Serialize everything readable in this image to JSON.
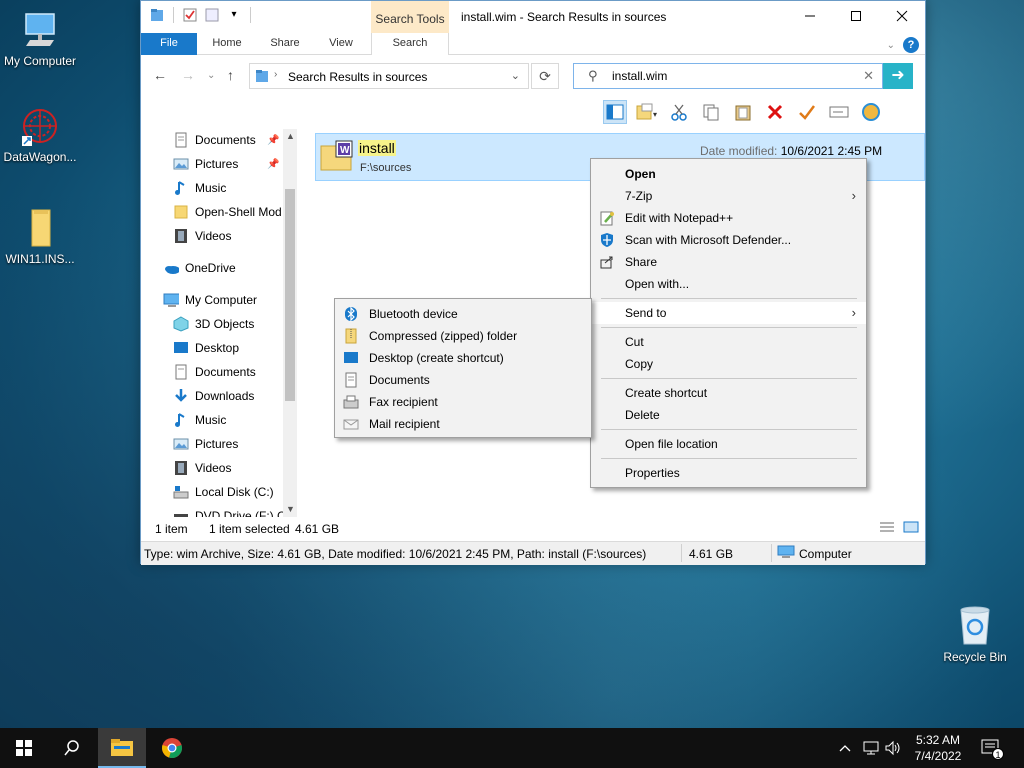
{
  "desktop": {
    "icons": [
      {
        "label": "My Computer"
      },
      {
        "label": "DataWagon..."
      },
      {
        "label": "WIN11.INS..."
      },
      {
        "label": "Recycle Bin"
      }
    ]
  },
  "window": {
    "title": "install.wim - Search Results in sources",
    "context_tab": "Search Tools",
    "tabs": [
      "File",
      "Home",
      "Share",
      "View",
      "Search"
    ],
    "address": "Search Results in sources",
    "search_value": "install.wim",
    "nav": {
      "quick_access": [
        {
          "label": "Documents",
          "pinned": true
        },
        {
          "label": "Pictures",
          "pinned": true
        },
        {
          "label": "Music",
          "pinned": false
        },
        {
          "label": "Open-Shell Mod",
          "pinned": false
        },
        {
          "label": "Videos",
          "pinned": false
        }
      ],
      "onedrive": "OneDrive",
      "computer": "My Computer",
      "computer_items": [
        "3D Objects",
        "Desktop",
        "Documents",
        "Downloads",
        "Music",
        "Pictures",
        "Videos",
        "Local Disk (C:)",
        "DVD Drive (F:) C("
      ]
    },
    "file": {
      "name": "install",
      "path": "F:\\sources",
      "modified_label": "Date modified:",
      "modified_value": "10/6/2021 2:45 PM"
    },
    "status": {
      "count": "1 item",
      "selected": "1 item selected",
      "size": "4.61 GB"
    },
    "details": {
      "info": "Type: wim Archive, Size: 4.61 GB, Date modified: 10/6/2021 2:45 PM, Path: install (F:\\sources)",
      "size": "4.61 GB",
      "location": "Computer"
    }
  },
  "context_menu": {
    "items": [
      {
        "label": "Open",
        "bold": true
      },
      {
        "label": "7-Zip",
        "submenu": true
      },
      {
        "label": "Edit with Notepad++"
      },
      {
        "label": "Scan with Microsoft Defender..."
      },
      {
        "label": "Share"
      },
      {
        "label": "Open with..."
      },
      {
        "label": "Send to",
        "submenu": true,
        "highlighted": true
      },
      {
        "label": "Cut"
      },
      {
        "label": "Copy"
      },
      {
        "label": "Create shortcut"
      },
      {
        "label": "Delete"
      },
      {
        "label": "Open file location"
      },
      {
        "label": "Properties"
      }
    ]
  },
  "sendto_menu": {
    "items": [
      {
        "label": "Bluetooth device"
      },
      {
        "label": "Compressed (zipped) folder"
      },
      {
        "label": "Desktop (create shortcut)"
      },
      {
        "label": "Documents"
      },
      {
        "label": "Fax recipient"
      },
      {
        "label": "Mail recipient"
      }
    ]
  },
  "taskbar": {
    "time": "5:32 AM",
    "date": "7/4/2022",
    "notifications": "1"
  },
  "colors": {
    "accent": "#1979ca",
    "selection": "#cce8ff",
    "highlight_text": "#f6f38a",
    "context_tab": "#fde9c8"
  }
}
